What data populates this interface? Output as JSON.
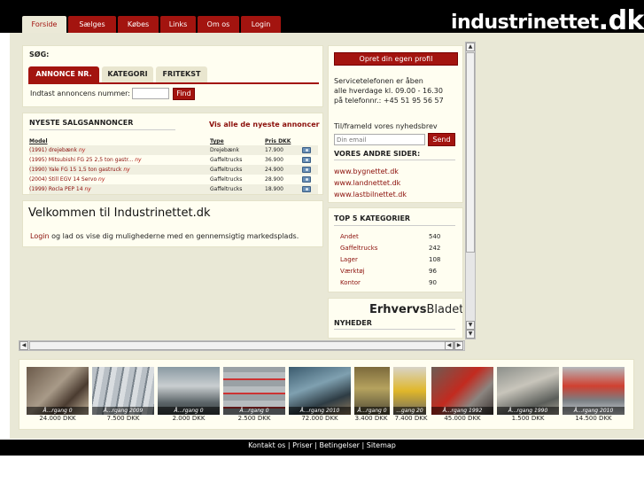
{
  "nav": [
    "Forside",
    "Sælges",
    "Købes",
    "Links",
    "Om os",
    "Login"
  ],
  "logo": {
    "main": "industrinettet",
    "dk": ".dk"
  },
  "search": {
    "title": "SØG:",
    "tabs": [
      "ANNONCE NR.",
      "KATEGORI",
      "FRITEKST"
    ],
    "label": "Indtast annoncens nummer:",
    "value": "",
    "button": "Find"
  },
  "newest": {
    "title": "NYESTE SALGSANNONCER",
    "see_all": "Vis alle de nyeste annoncer",
    "columns": [
      "Model",
      "Type",
      "Pris DKK"
    ],
    "rows": [
      {
        "model": "(1991) drejebænk",
        "new": "ny",
        "type": "Drejebænk",
        "price": "17.900"
      },
      {
        "model": "(1995) Mitsubishi FG 25 2,5 ton gastr...",
        "new": "ny",
        "type": "Gaffeltrucks",
        "price": "36.900"
      },
      {
        "model": "(1990) Yale FG 15 1,5 ton gastruck",
        "new": "ny",
        "type": "Gaffeltrucks",
        "price": "24.900"
      },
      {
        "model": "(2004) Still EGV 14 Servo",
        "new": "ny",
        "type": "Gaffeltrucks",
        "price": "28.900"
      },
      {
        "model": "(1999) Rocla PEP 14",
        "new": "ny",
        "type": "Gaffeltrucks",
        "price": "18.900"
      }
    ]
  },
  "welcome": {
    "title": "Velkommen til Industrinettet.dk",
    "login": "Login",
    "text": "og lad os vise dig mulighederne med en gennemsigtig markedsplads."
  },
  "right": {
    "profile_button": "Opret din egen profil",
    "service_line1": "Servicetelefonen er åben",
    "service_line2": "alle hverdage kl. 09.00 - 16.30",
    "service_line3": "på telefonnr.: +45 51 95 56 57",
    "newsletter_label": "Til/frameld vores nyhedsbrev",
    "email_placeholder": "Din email",
    "send": "Send",
    "other_title": "VORES ANDRE SIDER:",
    "other_sites": [
      "www.bygnettet.dk",
      "www.landnettet.dk",
      "www.lastbilnettet.dk"
    ],
    "top5_title": "TOP 5 KATEGORIER",
    "top5": [
      {
        "name": "Andet",
        "count": "540"
      },
      {
        "name": "Gaffeltrucks",
        "count": "242"
      },
      {
        "name": "Lager",
        "count": "108"
      },
      {
        "name": "Værktøj",
        "count": "96"
      },
      {
        "name": "Kontor",
        "count": "90"
      }
    ],
    "eb_logo_a": "Erhvervs",
    "eb_logo_b": "Bladet",
    "news_title": "NYHEDER"
  },
  "thumbs": [
    {
      "cap": "Å...rgang 0",
      "price": "24.000 DKK"
    },
    {
      "cap": "Å...rgang 2009",
      "price": "7.500 DKK"
    },
    {
      "cap": "Å...rgang 0",
      "price": "2.000 DKK"
    },
    {
      "cap": "Å...rgang 0",
      "price": "2.500 DKK"
    },
    {
      "cap": "Å...rgang 2010",
      "price": "72.000 DKK"
    },
    {
      "cap": "Å...rgang 0",
      "price": "3.400 DKK"
    },
    {
      "cap": "...gang 20",
      "price": "7.400 DKK"
    },
    {
      "cap": "Å...rgang 1992",
      "price": "45.000 DKK"
    },
    {
      "cap": "Å...rgang 1990",
      "price": "1.500 DKK"
    },
    {
      "cap": "Å...rgang 2010",
      "price": "14.500 DKK"
    }
  ],
  "footer": [
    "Kontakt os",
    "Priser",
    "Betingelser",
    "Sitemap"
  ],
  "colors": {
    "brand_red": "#a3140f",
    "frame": "#e9e8d6",
    "panel": "#fffef1"
  }
}
